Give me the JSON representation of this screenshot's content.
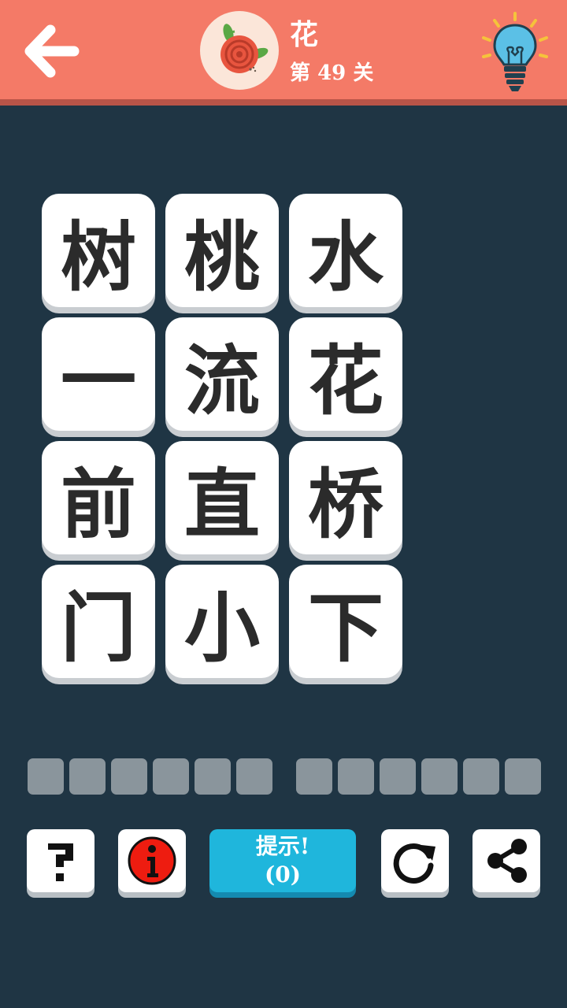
{
  "header": {
    "back_icon": "back-arrow-icon",
    "category": "花",
    "level_prefix": "第",
    "level_number": "49",
    "level_suffix": "关",
    "avatar_icon": "rose-icon",
    "bulb_icon": "lightbulb-icon",
    "colors": {
      "bar": "#f47a67",
      "bar_shadow": "#b85448"
    }
  },
  "board": {
    "tiles": [
      "树",
      "桃",
      "水",
      "一",
      "流",
      "花",
      "前",
      "直",
      "桥",
      "门",
      "小",
      "下"
    ]
  },
  "answer": {
    "word1_slots": 6,
    "word2_slots": 6
  },
  "toolbar": {
    "help_icon": "question-mark-icon",
    "info_icon": "info-icon",
    "hint_label": "提示!",
    "hint_count": "(0)",
    "reset_icon": "refresh-icon",
    "share_icon": "share-icon",
    "colors": {
      "hint": "#1fb6dc"
    }
  }
}
